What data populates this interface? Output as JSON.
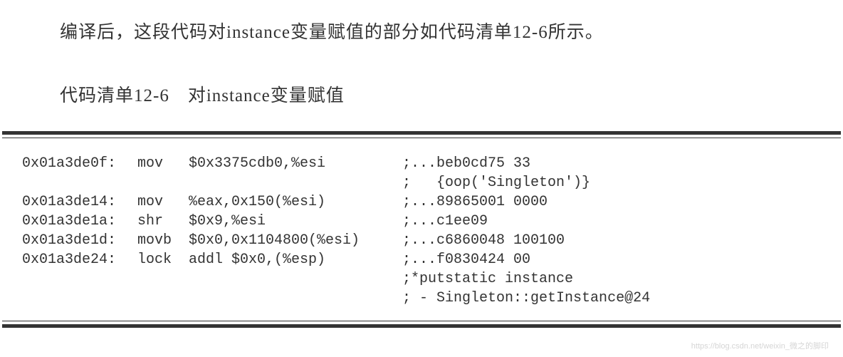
{
  "intro": "编译后，这段代码对instance变量赋值的部分如代码清单12-6所示。",
  "listing_title": "代码清单12-6　对instance变量赋值",
  "code": {
    "lines": [
      {
        "addr": "0x01a3de0f:",
        "mnemonic": "mov",
        "operands": "$0x3375cdb0,%esi",
        "comment": ";...beb0cd75 33"
      },
      {
        "addr": "",
        "mnemonic": "",
        "operands": "",
        "comment": ";   {oop('Singleton')}"
      },
      {
        "addr": "0x01a3de14:",
        "mnemonic": "mov",
        "operands": "%eax,0x150(%esi)",
        "comment": ";...89865001 0000"
      },
      {
        "addr": "0x01a3de1a:",
        "mnemonic": "shr",
        "operands": "$0x9,%esi",
        "comment": ";...c1ee09"
      },
      {
        "addr": "0x01a3de1d:",
        "mnemonic": "movb",
        "operands": "$0x0,0x1104800(%esi)",
        "comment": ";...c6860048 100100"
      },
      {
        "addr": "0x01a3de24:",
        "mnemonic": "lock",
        "operands": "addl $0x0,(%esp)",
        "comment": ";...f0830424 00"
      },
      {
        "addr": "",
        "mnemonic": "",
        "operands": "",
        "comment": ";*putstatic instance"
      },
      {
        "addr": "",
        "mnemonic": "",
        "operands": "",
        "comment": "; - Singleton::getInstance@24"
      }
    ]
  },
  "watermark": "https://blog.csdn.net/weixin_微之的脚印"
}
